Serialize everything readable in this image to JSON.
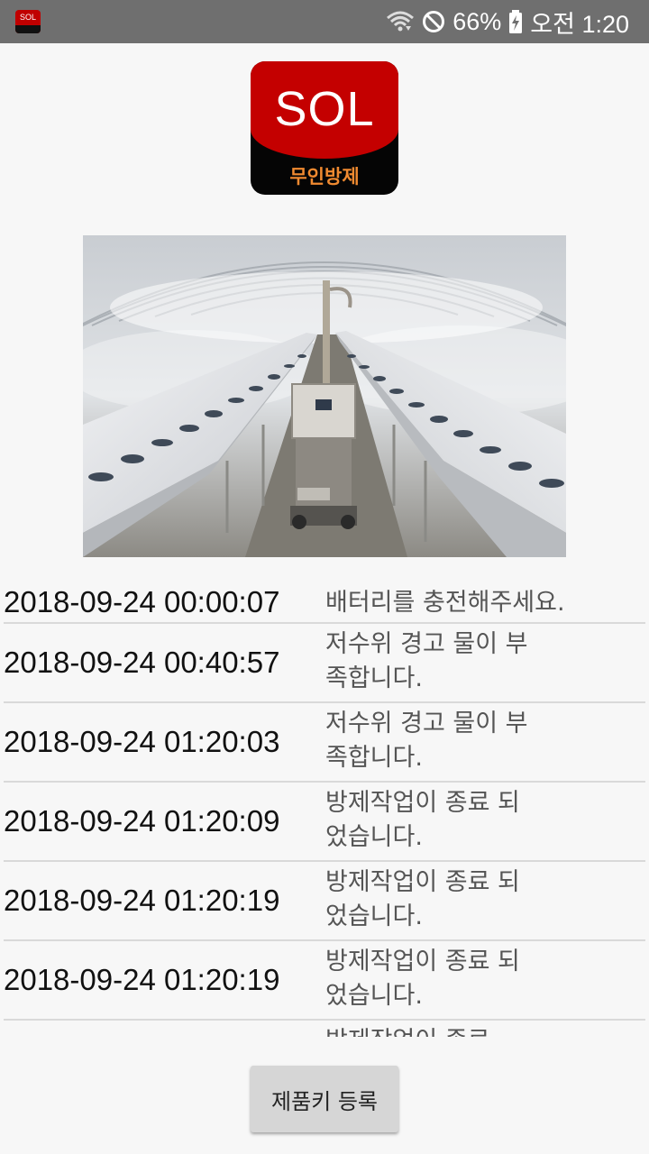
{
  "status_bar": {
    "app_icon_text": "SOL",
    "battery_percent": "66%",
    "time": "오전 1:20",
    "icons": [
      "wifi-icon",
      "do-not-disturb-icon",
      "battery-charging-icon"
    ]
  },
  "logo": {
    "title": "SOL",
    "subtitle": "무인방제",
    "colors": {
      "top": "#c40000",
      "bottom": "#050505",
      "subtitle": "#f08a30"
    }
  },
  "photo": {
    "description_icon": "greenhouse-sprayer-photo"
  },
  "log": {
    "entries": [
      {
        "timestamp": "2018-09-24 00:00:07",
        "message": "배터리를 충전해주세요."
      },
      {
        "timestamp": "2018-09-24 00:40:57",
        "message": "저수위 경고 물이 부족합니다."
      },
      {
        "timestamp": "2018-09-24 01:20:03",
        "message": "저수위 경고 물이 부족합니다."
      },
      {
        "timestamp": "2018-09-24 01:20:09",
        "message": "방제작업이 종료 되었습니다."
      },
      {
        "timestamp": "2018-09-24 01:20:19",
        "message": "방제작업이 종료 되었습니다."
      },
      {
        "timestamp": "2018-09-24 01:20:19",
        "message": "방제작업이 종료 되었습니다."
      },
      {
        "timestamp": "",
        "message": "방제작업이 종료"
      }
    ]
  },
  "actions": {
    "register_label": "제품키 등록"
  }
}
